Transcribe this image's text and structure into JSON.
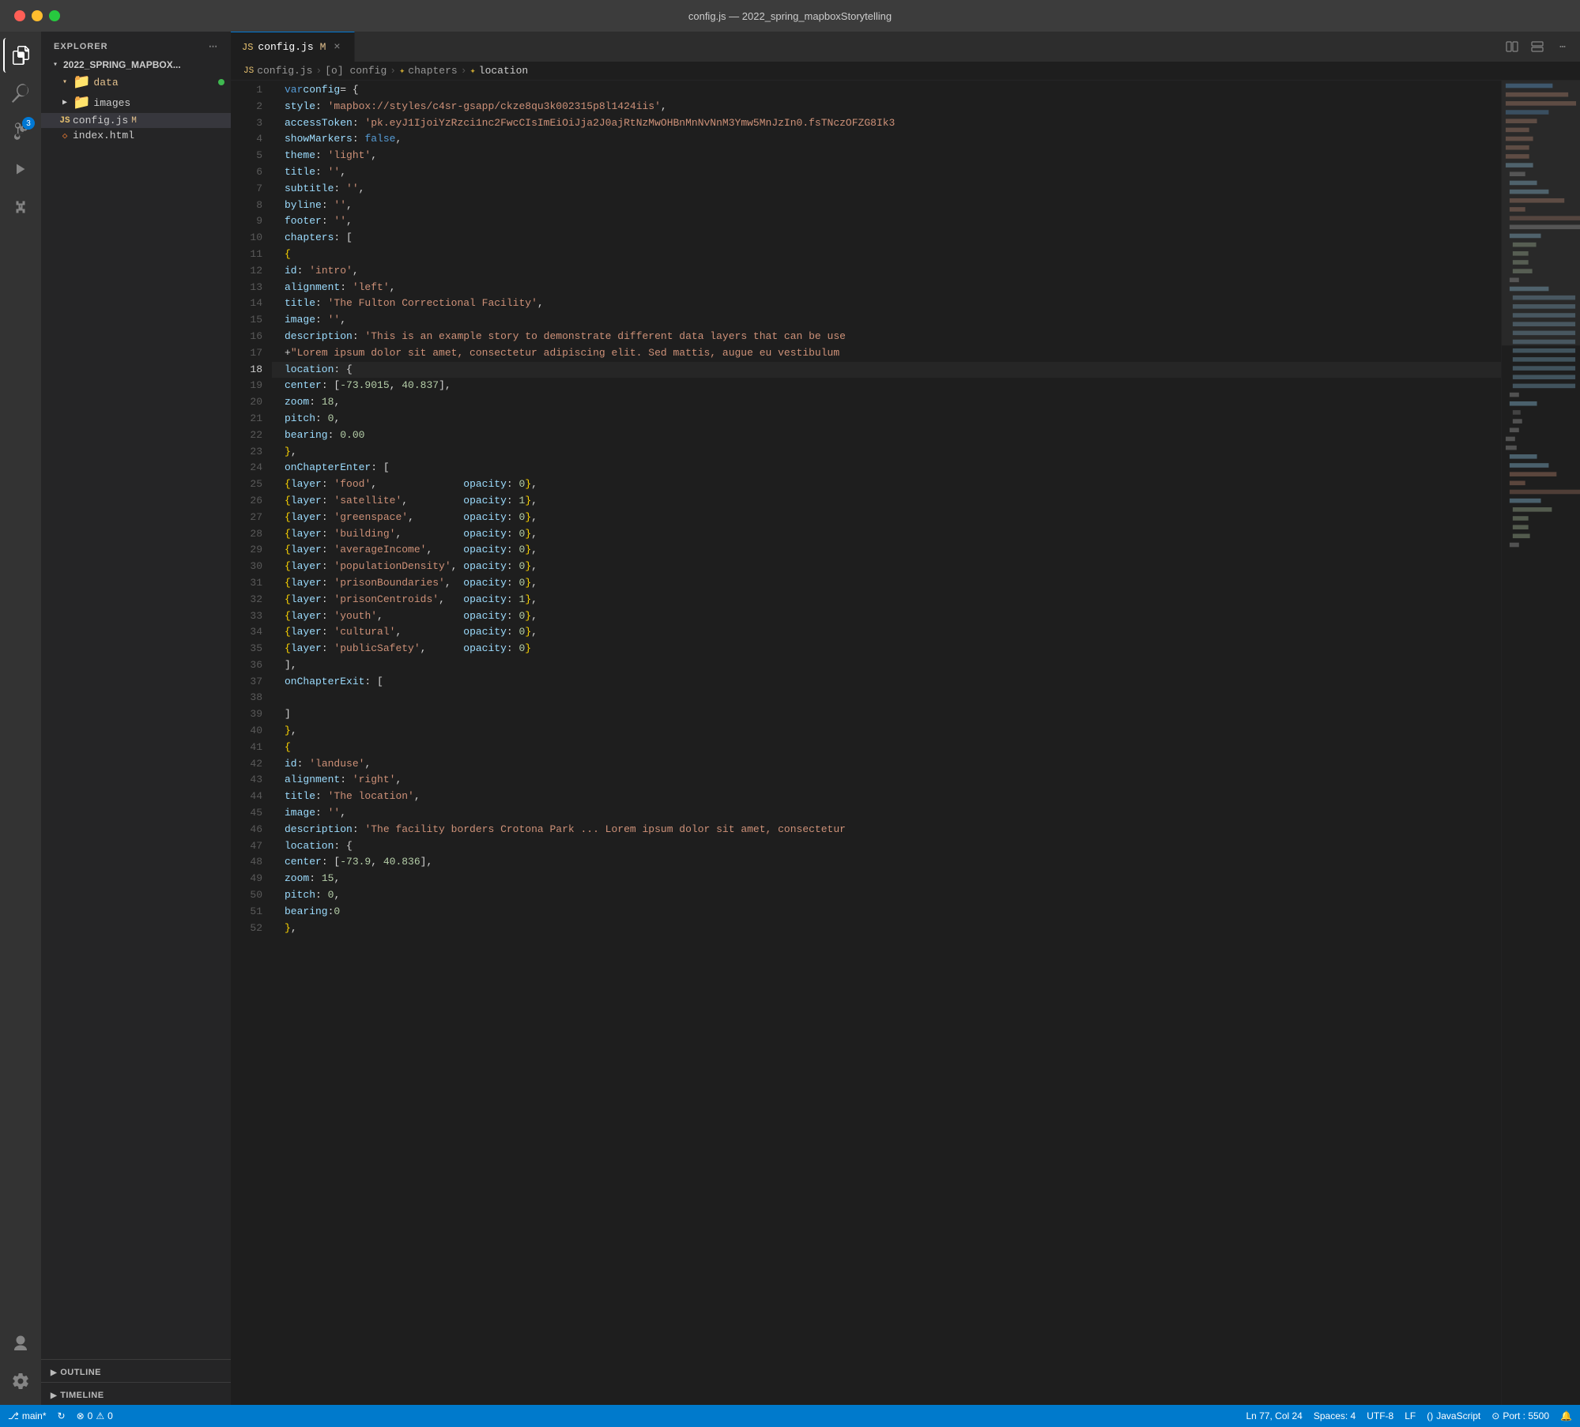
{
  "titlebar": {
    "title": "config.js — 2022_spring_mapboxStorytelling"
  },
  "tabs": [
    {
      "id": "config-js",
      "icon": "JS",
      "label": "config.js",
      "modified": "M",
      "active": true
    }
  ],
  "breadcrumb": {
    "items": [
      "config.js",
      "[o] config",
      "chapters",
      "location"
    ]
  },
  "sidebar": {
    "explorer_label": "EXPLORER",
    "root": "2022_SPRING_MAPBOX...",
    "items": [
      {
        "type": "folder",
        "label": "data",
        "level": 1,
        "expanded": true,
        "dot": true
      },
      {
        "type": "folder",
        "label": "images",
        "level": 1,
        "expanded": false
      },
      {
        "type": "file",
        "label": "config.js",
        "level": 1,
        "modified": "M",
        "selected": true
      },
      {
        "type": "file",
        "label": "index.html",
        "level": 1
      }
    ]
  },
  "sections": {
    "outline": "OUTLINE",
    "timeline": "TIMELINE"
  },
  "code": {
    "lines": [
      {
        "n": 1,
        "text": "var config = {"
      },
      {
        "n": 2,
        "text": "    style: 'mapbox://styles/c4sr-gsapp/ckze8qu3k002315p8l1424iis',"
      },
      {
        "n": 3,
        "text": "    accessToken: 'pk.eyJ1IjoiYzRzci1nc2FwcCIsImEiOiJja2J0ajRtNzMwOHBnMnNvNnM3Ymw5MnJzIn0.fsTNczOFZG8Ik3"
      },
      {
        "n": 4,
        "text": "    showMarkers: false,"
      },
      {
        "n": 5,
        "text": "    theme: 'light',"
      },
      {
        "n": 6,
        "text": "    title: '',"
      },
      {
        "n": 7,
        "text": "    subtitle: '',"
      },
      {
        "n": 8,
        "text": "    byline: '',"
      },
      {
        "n": 9,
        "text": "    footer: '',"
      },
      {
        "n": 10,
        "text": "    chapters: ["
      },
      {
        "n": 11,
        "text": "        {"
      },
      {
        "n": 12,
        "text": "            id: 'intro',"
      },
      {
        "n": 13,
        "text": "            alignment: 'left',"
      },
      {
        "n": 14,
        "text": "            title: 'The Fulton Correctional Facility',"
      },
      {
        "n": 15,
        "text": "            image: '',"
      },
      {
        "n": 16,
        "text": "            description: 'This is an example story to demonstrate different data layers that can be use"
      },
      {
        "n": 17,
        "text": "            +\"Lorem ipsum dolor sit amet, consectetur adipiscing elit. Sed mattis, augue eu vestibulum"
      },
      {
        "n": 18,
        "text": "            location: {"
      },
      {
        "n": 19,
        "text": "                center: [-73.9015, 40.837],"
      },
      {
        "n": 20,
        "text": "                zoom: 18,"
      },
      {
        "n": 21,
        "text": "                pitch: 0,"
      },
      {
        "n": 22,
        "text": "                bearing: 0.00"
      },
      {
        "n": 23,
        "text": "            },"
      },
      {
        "n": 24,
        "text": "            onChapterEnter: ["
      },
      {
        "n": 25,
        "text": "                {layer: 'food',              opacity: 0 },"
      },
      {
        "n": 26,
        "text": "                {layer: 'satellite',         opacity: 1},"
      },
      {
        "n": 27,
        "text": "                {layer: 'greenspace',        opacity: 0},"
      },
      {
        "n": 28,
        "text": "                {layer: 'building',          opacity: 0 },"
      },
      {
        "n": 29,
        "text": "                {layer: 'averageIncome',     opacity: 0},"
      },
      {
        "n": 30,
        "text": "                {layer: 'populationDensity', opacity: 0},"
      },
      {
        "n": 31,
        "text": "                {layer: 'prisonBoundaries',  opacity: 0},"
      },
      {
        "n": 32,
        "text": "                {layer: 'prisonCentroids',   opacity: 1},"
      },
      {
        "n": 33,
        "text": "                {layer: 'youth',             opacity: 0},"
      },
      {
        "n": 34,
        "text": "                {layer: 'cultural',          opacity: 0},"
      },
      {
        "n": 35,
        "text": "                {layer: 'publicSafety',      opacity: 0}"
      },
      {
        "n": 36,
        "text": "            ],"
      },
      {
        "n": 37,
        "text": "            onChapterExit: ["
      },
      {
        "n": 38,
        "text": ""
      },
      {
        "n": 39,
        "text": "            ]"
      },
      {
        "n": 40,
        "text": "        },"
      },
      {
        "n": 41,
        "text": "        {"
      },
      {
        "n": 42,
        "text": "            id: 'landuse',"
      },
      {
        "n": 43,
        "text": "            alignment: 'right',"
      },
      {
        "n": 44,
        "text": "            title: 'The location',"
      },
      {
        "n": 45,
        "text": "            image: '',"
      },
      {
        "n": 46,
        "text": "            description: 'The facility borders Crotona Park ... Lorem ipsum dolor sit amet, consectetur"
      },
      {
        "n": 47,
        "text": "            location: {"
      },
      {
        "n": 48,
        "text": "                center: [-73.9, 40.836],"
      },
      {
        "n": 49,
        "text": "                zoom: 15,"
      },
      {
        "n": 50,
        "text": "                pitch: 0,"
      },
      {
        "n": 51,
        "text": "                bearing:0"
      },
      {
        "n": 52,
        "text": "        },"
      }
    ]
  },
  "statusbar": {
    "branch": "main*",
    "sync": "",
    "errors": "0",
    "warnings": "0",
    "position": "Ln 77, Col 24",
    "spaces": "Spaces: 4",
    "encoding": "UTF-8",
    "eol": "LF",
    "language": "JavaScript",
    "port": "Port : 5500"
  },
  "activity": {
    "icons": [
      "explorer",
      "search",
      "source-control",
      "run",
      "extensions"
    ],
    "bottom": [
      "account",
      "settings"
    ]
  }
}
